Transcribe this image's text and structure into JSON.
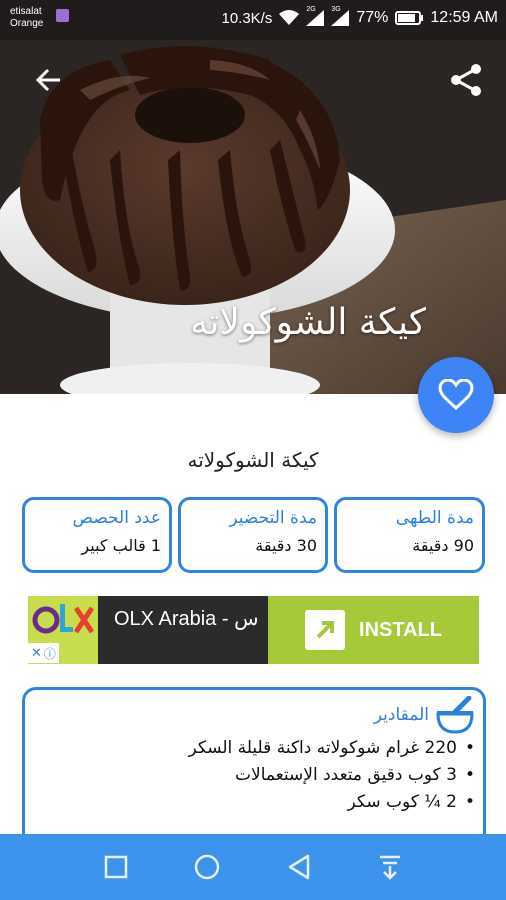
{
  "status_bar": {
    "carrier_line1": "etisalat",
    "carrier_line2": "Orange",
    "network_speed": "10.3K/s",
    "signal1_tag": "2G",
    "signal2_tag": "3G",
    "battery_percent": "77%",
    "time": "12:59 AM"
  },
  "hero": {
    "title": "كيكة الشوكولاته",
    "back_icon": "arrow-back-icon",
    "share_icon": "share-icon"
  },
  "favorite": {
    "icon": "heart-outline-icon",
    "color": "#3f84f6"
  },
  "recipe": {
    "title": "كيكة الشوكولاته"
  },
  "info_cards": [
    {
      "label": "مدة الطهى",
      "value": "90 دقيقة"
    },
    {
      "label": "مدة التحضير",
      "value": "30 دقيقة"
    },
    {
      "label": "عدد الحصص",
      "value": "1 قالب كبير"
    }
  ],
  "ad": {
    "logo_text": "OLX",
    "text": "OLX Arabia - س",
    "install_label": "INSTALL",
    "choices": "ⓘ"
  },
  "ingredients": {
    "label": "المقادير",
    "icon": "mortar-pestle-icon",
    "items": [
      "220 غرام شوكولاته داكنة قليلة السكر",
      "3 كوب دقيق متعدد الإستعمالات",
      "2 ¼ كوب سكر"
    ]
  },
  "navbar": {
    "icons": [
      "square-icon",
      "circle-home-icon",
      "triangle-back-icon",
      "notification-pull-icon"
    ]
  },
  "colors": {
    "accent": "#2e83e3",
    "navbar": "#3d92ec",
    "ad_green": "#a6c93a"
  }
}
